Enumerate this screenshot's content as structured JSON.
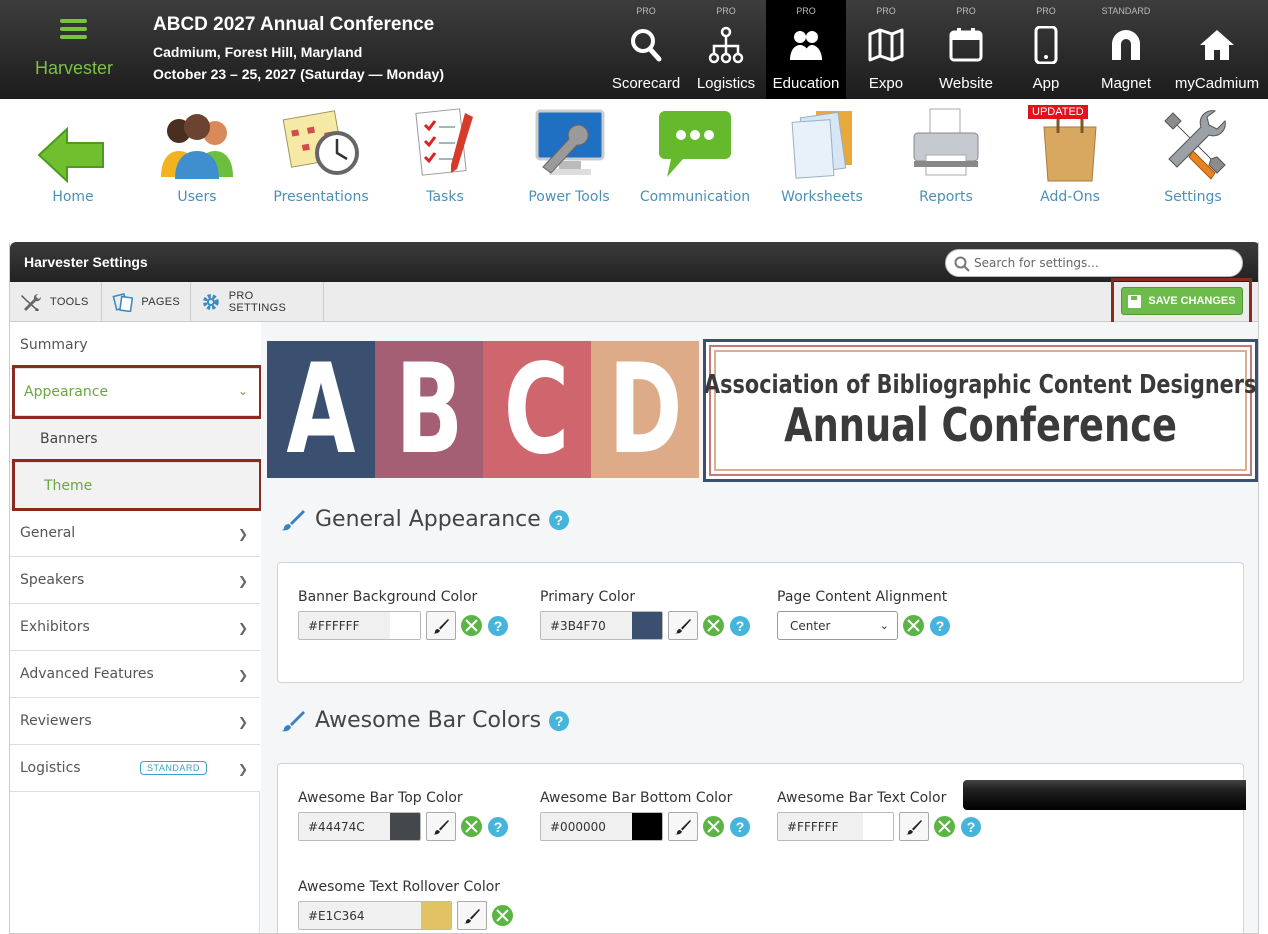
{
  "brand": {
    "name": "Harvester",
    "menu_icon": "hamburger-menu-icon"
  },
  "conference": {
    "title": "ABCD 2027 Annual Conference",
    "location": "Cadmium, Forest Hill, Maryland",
    "dates": "October 23 – 25, 2027 (Saturday — Monday)"
  },
  "top_nav": [
    {
      "tier": "PRO",
      "label": "Scorecard",
      "icon": "search-icon"
    },
    {
      "tier": "PRO",
      "label": "Logistics",
      "icon": "sitemap-icon"
    },
    {
      "tier": "PRO",
      "label": "Education",
      "icon": "users-icon",
      "active": true
    },
    {
      "tier": "PRO",
      "label": "Expo",
      "icon": "map-icon"
    },
    {
      "tier": "PRO",
      "label": "Website",
      "icon": "calendar-icon"
    },
    {
      "tier": "PRO",
      "label": "App",
      "icon": "phone-icon"
    },
    {
      "tier": "STANDARD",
      "label": "Magnet",
      "icon": "magnet-icon"
    },
    {
      "tier": "",
      "label": "myCadmium",
      "icon": "home-icon"
    }
  ],
  "modules": [
    {
      "label": "Home",
      "icon": "arrow-left-icon"
    },
    {
      "label": "Users",
      "icon": "people-icon"
    },
    {
      "label": "Presentations",
      "icon": "calendar-clock-icon"
    },
    {
      "label": "Tasks",
      "icon": "checklist-icon"
    },
    {
      "label": "Power Tools",
      "icon": "monitor-wrench-icon"
    },
    {
      "label": "Communication",
      "icon": "chat-bubble-icon"
    },
    {
      "label": "Worksheets",
      "icon": "documents-icon"
    },
    {
      "label": "Reports",
      "icon": "printer-icon"
    },
    {
      "label": "Add-Ons",
      "icon": "shopping-bag-icon",
      "badge": "UPDATED"
    },
    {
      "label": "Settings",
      "icon": "tools-icon"
    }
  ],
  "settings": {
    "title": "Harvester Settings",
    "search_placeholder": "Search for settings...",
    "toolbar": {
      "tools": "TOOLS",
      "pages": "PAGES",
      "pro_settings": "PRO SETTINGS",
      "save": "SAVE CHANGES"
    },
    "sidebar": {
      "summary": "Summary",
      "appearance": "Appearance",
      "banners": "Banners",
      "theme": "Theme",
      "general": "General",
      "speakers": "Speakers",
      "exhibitors": "Exhibitors",
      "advanced": "Advanced Features",
      "reviewers": "Reviewers",
      "logistics": "Logistics",
      "logistics_badge": "STANDARD"
    },
    "banner": {
      "letters": [
        "A",
        "B",
        "C",
        "D"
      ],
      "letter_colors": [
        "#3B4F70",
        "#A55F74",
        "#D0666D",
        "#DDAB88"
      ],
      "line1": "Association of Bibliographic Content Designers",
      "line2": "Annual Conference"
    },
    "general_appearance": {
      "heading": "General Appearance",
      "banner_bg": {
        "label": "Banner Background Color",
        "value": "#FFFFFF",
        "swatch": "#FFFFFF"
      },
      "primary": {
        "label": "Primary Color",
        "value": "#3B4F70",
        "swatch": "#3B4F70"
      },
      "alignment": {
        "label": "Page Content Alignment",
        "value": "Center"
      }
    },
    "awesome_bar": {
      "heading": "Awesome Bar Colors",
      "top": {
        "label": "Awesome Bar Top Color",
        "value": "#44474C",
        "swatch": "#44474C"
      },
      "bottom": {
        "label": "Awesome Bar Bottom Color",
        "value": "#000000",
        "swatch": "#000000"
      },
      "text": {
        "label": "Awesome Bar Text Color",
        "value": "#FFFFFF",
        "swatch": "#FFFFFF"
      },
      "rollover": {
        "label": "Awesome Text Rollover Color",
        "value": "#E1C364",
        "swatch": "#E1C364"
      }
    }
  },
  "colors": {
    "brand_green": "#7BC243",
    "highlight_border": "#8B2A1E",
    "link_blue": "#4A90B8",
    "help_blue": "#45B5DC"
  }
}
